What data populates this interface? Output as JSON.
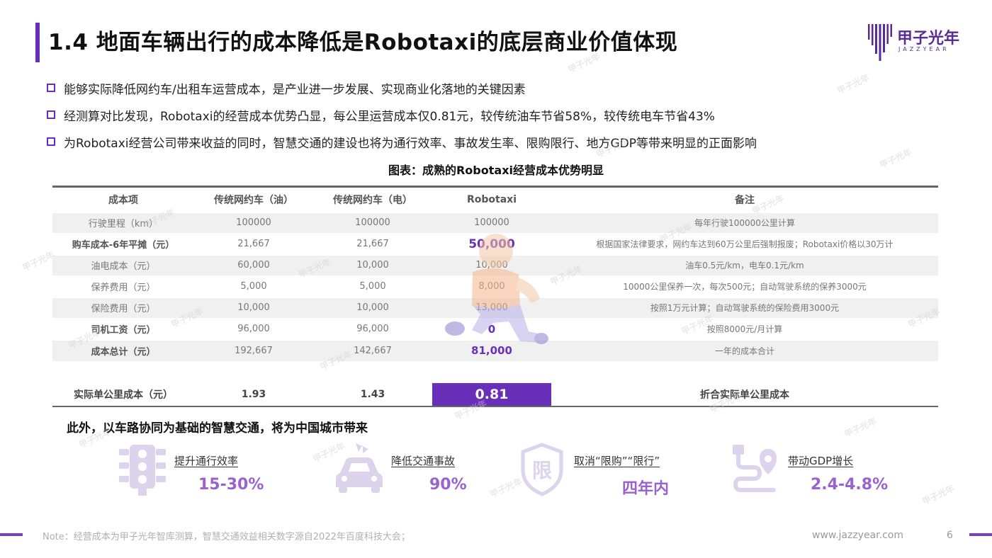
{
  "header": {
    "title": "1.4 地面车辆出行的成本降低是Robotaxi的底层商业价值体现",
    "logo_cn": "甲子光年",
    "logo_en": "JAZZYEAR"
  },
  "bullets": [
    "能够实际降低网约车/出租车运营成本，是产业进一步发展、实现商业化落地的关键因素",
    "经测算对比发现，Robotaxi的经营成本优势凸显，每公里运营成本仅0.81元，较传统油车节省58%，较传统电车节省43%",
    "为Robotaxi经营公司带来收益的同时，智慧交通的建设也将为通行效率、事故发生率、限购限行、地方GDP等带来明显的正面影响"
  ],
  "table": {
    "caption": "图表：成熟的Robotaxi经营成本优势明显",
    "headers": [
      "成本项",
      "传统网约车（油）",
      "传统网约车（电）",
      "Robotaxi",
      "备注"
    ],
    "rows": [
      {
        "item": "行驶里程（km）",
        "oil": "100000",
        "ev": "100000",
        "robotaxi": "100000",
        "note": "每年行驶100000公里计算"
      },
      {
        "item": "购车成本-6年平摊（元）",
        "oil": "21,667",
        "ev": "21,667",
        "robotaxi": "50,000",
        "note": "根据国家法律要求，网约车达到60万公里后强制报废；Robotaxi价格以30万计"
      },
      {
        "item": "油电成本（元）",
        "oil": "60,000",
        "ev": "10,000",
        "robotaxi": "10,000",
        "note": "油车0.5元/km，电车0.1元/km"
      },
      {
        "item": "保养费用（元）",
        "oil": "5,000",
        "ev": "5,000",
        "robotaxi": "8,000",
        "note": "10000公里保养一次，每次500元；自动驾驶系统的保养3000元"
      },
      {
        "item": "保险费用（元）",
        "oil": "10,000",
        "ev": "10,000",
        "robotaxi": "13,000",
        "note": "按照1万元计算；自动驾驶系统的保险费用3000元"
      },
      {
        "item": "司机工资（元）",
        "oil": "96,000",
        "ev": "96,000",
        "robotaxi": "0",
        "note": "按照8000元/月计算"
      },
      {
        "item": "成本总计（元）",
        "oil": "192,667",
        "ev": "142,667",
        "robotaxi": "81,000",
        "note": "一年的成本合计"
      }
    ],
    "total": {
      "item": "实际单公里成本（元）",
      "oil": "1.93",
      "ev": "1.43",
      "robotaxi": "0.81",
      "note": "折合实际单公里成本"
    }
  },
  "benefits": {
    "heading": "此外，以车路协同为基础的智慧交通，将为中国城市带来",
    "items": [
      {
        "label": "提升通行效率",
        "value": "15-30%",
        "icon": "traffic-light-icon"
      },
      {
        "label": "降低交通事故",
        "value": "90%",
        "icon": "car-crash-icon"
      },
      {
        "label": "取消“限购”“限行”",
        "value": "四年内",
        "icon": "restriction-shield-icon",
        "icon_text": "限"
      },
      {
        "label": "带动GDP增长",
        "value": "2.4-4.8%",
        "icon": "route-location-icon"
      }
    ]
  },
  "footer": {
    "note": "Note：经营成本为甲子光年智库测算，智慧交通效益相关数字源自2022年百度科技大会；",
    "url": "www.jazzyear.com",
    "page": "6"
  },
  "colors": {
    "accent": "#6a2fb8",
    "accent_light": "#9a62cf",
    "icon": "#ddd3ec"
  }
}
